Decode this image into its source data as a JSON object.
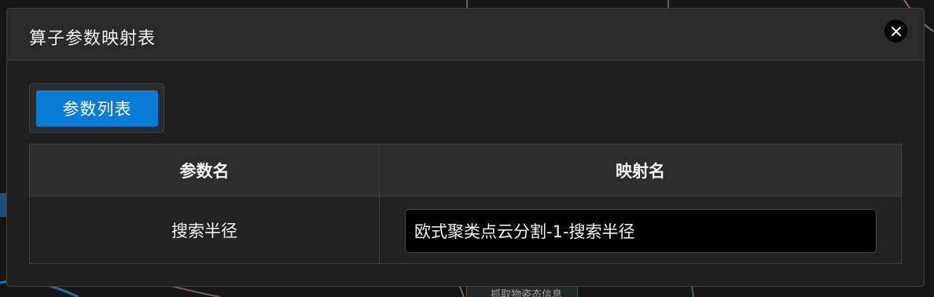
{
  "background": {
    "node_label": "抓取物姿态信息"
  },
  "dialog": {
    "title": "算子参数映射表",
    "close_icon": "close-icon",
    "tabs": [
      {
        "label": "参数列表",
        "active": true
      }
    ],
    "table": {
      "headers": [
        "参数名",
        "映射名"
      ],
      "rows": [
        {
          "param_name": "搜索半径",
          "mapping_name": "欧式聚类点云分割-1-搜索半径"
        }
      ]
    }
  },
  "colors": {
    "accent": "#0a7bd6",
    "dialog_bg": "#202020",
    "header_bg": "#2a2a2a",
    "input_bg": "#000000"
  }
}
